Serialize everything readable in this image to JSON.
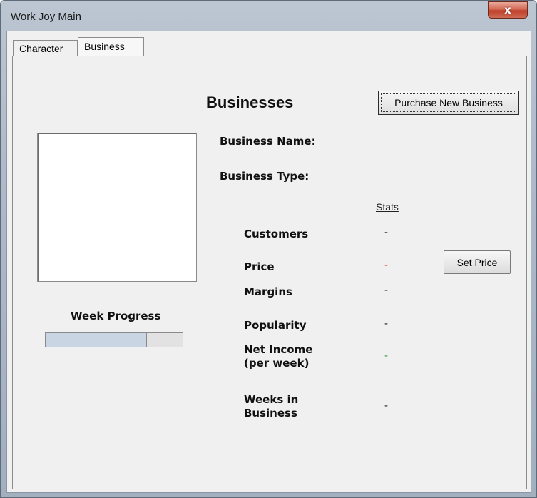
{
  "window": {
    "title": "Work Joy Main",
    "close_symbol": "x"
  },
  "tabs": [
    {
      "label": "Character",
      "active": false
    },
    {
      "label": "Business",
      "active": true
    }
  ],
  "business": {
    "heading": "Businesses",
    "purchase_button": "Purchase New Business",
    "name_label": "Business Name:",
    "type_label": "Business Type:",
    "stats_header": "Stats",
    "week_progress_label": "Week Progress",
    "week_progress_fraction": 0.74,
    "set_price_button": "Set Price",
    "stats": {
      "customers": {
        "label": "Customers",
        "value": "-"
      },
      "price": {
        "label": "Price",
        "value": "-",
        "color": "#d62020"
      },
      "margins": {
        "label": "Margins",
        "value": "-"
      },
      "popularity": {
        "label": "Popularity",
        "value": "-"
      },
      "net_income": {
        "label_line1": "Net Income",
        "label_line2": "(per week)",
        "value": "-",
        "color": "#3a9a3a"
      },
      "weeks": {
        "label_line1": "Weeks in",
        "label_line2": "Business",
        "value": "-"
      }
    }
  }
}
